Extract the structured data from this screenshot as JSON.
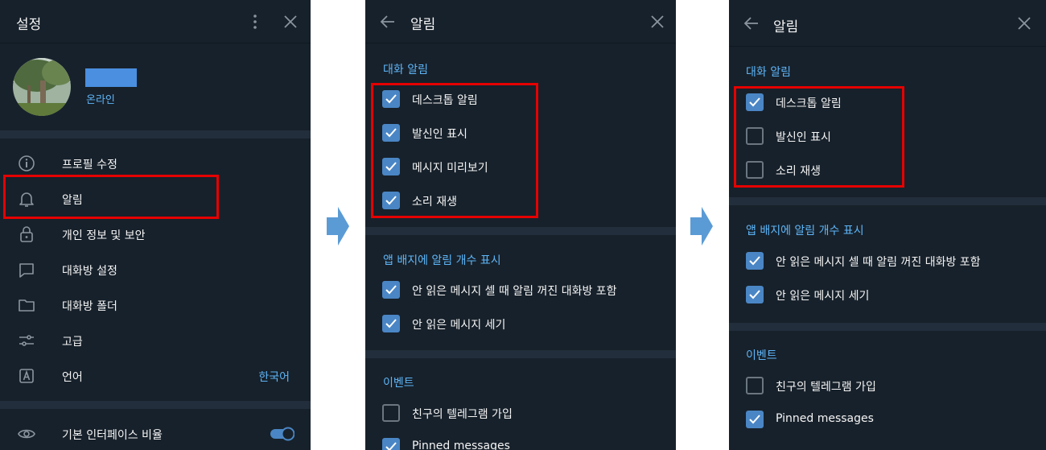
{
  "colors": {
    "panel_bg": "#17212b",
    "accent": "#5eb5f7",
    "checkbox_on": "#4a86c5",
    "highlight": "#e60000",
    "flow_arrow": "#5b9bd5"
  },
  "settings": {
    "title": "설정",
    "status": "온라인",
    "menu": [
      {
        "icon": "info-icon",
        "label": "프로필 수정"
      },
      {
        "icon": "bell-icon",
        "label": "알림"
      },
      {
        "icon": "lock-icon",
        "label": "개인 정보 및 보안"
      },
      {
        "icon": "chat-icon",
        "label": "대화방 설정"
      },
      {
        "icon": "folder-icon",
        "label": "대화방 폴더"
      },
      {
        "icon": "sliders-icon",
        "label": "고급"
      },
      {
        "icon": "language-icon",
        "label": "언어",
        "value": "한국어"
      }
    ],
    "scale": {
      "icon": "eye-icon",
      "label": "기본 인터페이스 비율",
      "enabled": true
    }
  },
  "notif_before": {
    "title": "알림",
    "sections": [
      {
        "title": "대화 알림",
        "items": [
          {
            "label": "데스크톱 알림",
            "checked": true
          },
          {
            "label": "발신인 표시",
            "checked": true
          },
          {
            "label": "메시지 미리보기",
            "checked": true
          },
          {
            "label": "소리 재생",
            "checked": true
          }
        ]
      },
      {
        "title": "앱 배지에 알림 개수 표시",
        "items": [
          {
            "label": "안 읽은 메시지 셀 때 알림 꺼진 대화방 포함",
            "checked": true
          },
          {
            "label": "안 읽은 메시지 세기",
            "checked": true
          }
        ]
      },
      {
        "title": "이벤트",
        "items": [
          {
            "label": "친구의 텔레그램 가입",
            "checked": false
          },
          {
            "label": "Pinned messages",
            "checked": true
          }
        ]
      }
    ]
  },
  "notif_after": {
    "title": "알림",
    "sections": [
      {
        "title": "대화 알림",
        "items": [
          {
            "label": "데스크톱 알림",
            "checked": true
          },
          {
            "label": "발신인 표시",
            "checked": false
          },
          {
            "label": "소리 재생",
            "checked": false
          }
        ]
      },
      {
        "title": "앱 배지에 알림 개수 표시",
        "items": [
          {
            "label": "안 읽은 메시지 셀 때 알림 꺼진 대화방 포함",
            "checked": true
          },
          {
            "label": "안 읽은 메시지 세기",
            "checked": true
          }
        ]
      },
      {
        "title": "이벤트",
        "items": [
          {
            "label": "친구의 텔레그램 가입",
            "checked": false
          },
          {
            "label": "Pinned messages",
            "checked": true
          }
        ]
      }
    ]
  }
}
